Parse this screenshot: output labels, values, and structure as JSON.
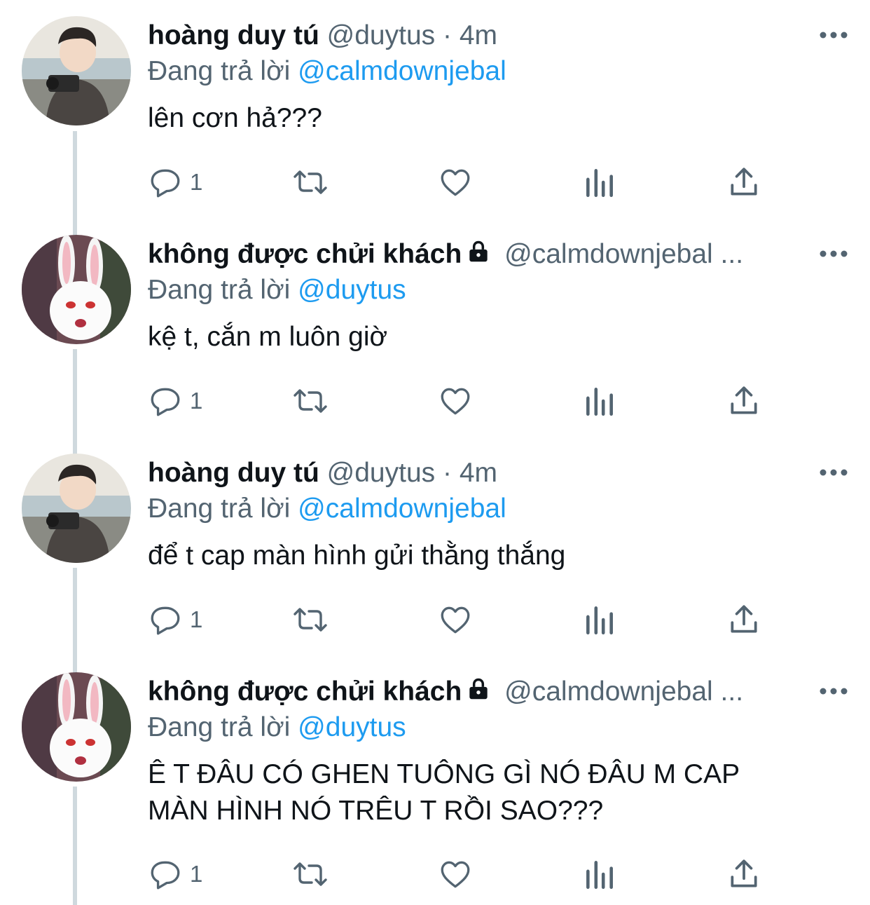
{
  "tweets": [
    {
      "name": "hoàng duy tú",
      "handle": "@duytus",
      "separator": "·",
      "time": "4m",
      "locked": false,
      "reply_prefix": "Đang trả lời",
      "reply_to": "@calmdownjebal",
      "text": "lên cơn hả???",
      "reply_count": "1",
      "avatar": "photo-boy-camera"
    },
    {
      "name": "không được chửi khách",
      "handle": "@calmdownjebal ...",
      "separator": "",
      "time": "",
      "locked": true,
      "reply_prefix": "Đang trả lời",
      "reply_to": "@duytus",
      "text": "kệ t, cắn m luôn giờ",
      "reply_count": "1",
      "avatar": "white-bunny"
    },
    {
      "name": "hoàng duy tú",
      "handle": "@duytus",
      "separator": "·",
      "time": "4m",
      "locked": false,
      "reply_prefix": "Đang trả lời",
      "reply_to": "@calmdownjebal",
      "text": "để t cap màn hình gửi thằng thắng",
      "reply_count": "1",
      "avatar": "photo-boy-camera"
    },
    {
      "name": "không được chửi khách",
      "handle": "@calmdownjebal ...",
      "separator": "",
      "time": "",
      "locked": true,
      "reply_prefix": "Đang trả lời",
      "reply_to": "@duytus",
      "text": "Ê T ĐÂU CÓ GHEN TUÔNG GÌ NÓ ĐÂU M CAP MÀN HÌNH NÓ TRÊU T RỒI SAO???",
      "reply_count": "1",
      "avatar": "white-bunny"
    }
  ],
  "icons": {
    "reply": "speech-bubble-icon",
    "retweet": "retweet-icon",
    "like": "heart-icon",
    "analytics": "bar-chart-icon",
    "share": "share-upload-icon",
    "more": "more-dots-icon",
    "lock": "lock-icon"
  },
  "colors": {
    "text": "#0f1419",
    "secondary": "#536471",
    "link": "#1d9bf0",
    "thread_line": "#cfd9de"
  }
}
